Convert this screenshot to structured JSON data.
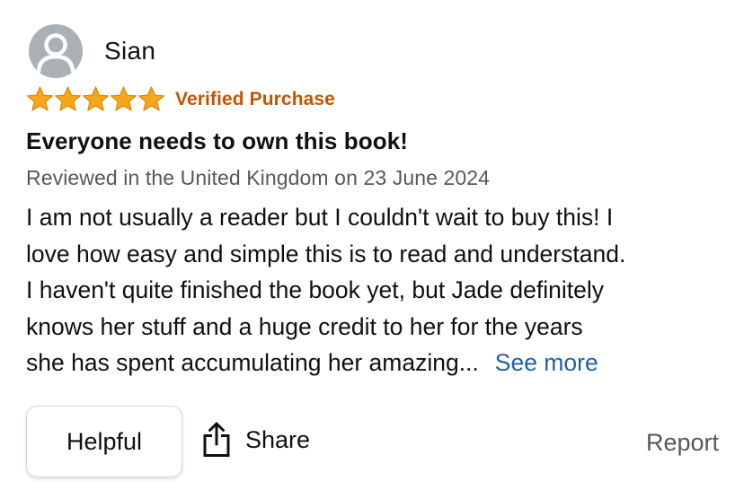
{
  "reviewer": {
    "name": "Sian",
    "avatar_icon": "user-silhouette-icon"
  },
  "rating": {
    "stars": 5,
    "max_stars": 5,
    "star_icon": "star-icon",
    "star_color": "#f7a51b",
    "verified_label": "Verified Purchase",
    "verified_color": "#c45500"
  },
  "review": {
    "title": "Everyone needs to own this book!",
    "meta": "Reviewed in the United Kingdom on 23 June 2024",
    "body_lines": [
      "I am not usually a reader but I couldn't wait to buy this! I",
      "love how easy and simple this is to read and understand.",
      "I haven't quite finished the book yet, but Jade definitely",
      "knows her stuff and a huge credit to her for the years",
      "she has spent accumulating her amazing..."
    ],
    "see_more_label": "See more",
    "link_color": "#2162a1"
  },
  "actions": {
    "helpful_label": "Helpful",
    "share_label": "Share",
    "share_icon": "share-icon",
    "report_label": "Report"
  }
}
